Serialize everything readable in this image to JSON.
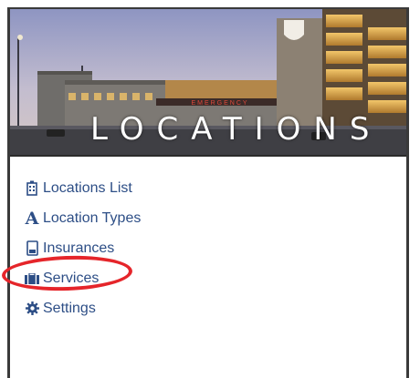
{
  "banner": {
    "title": "LOCATIONS",
    "sign_text": "EMERGENCY"
  },
  "menu": {
    "items": [
      {
        "label": "Locations List",
        "icon": "building-icon"
      },
      {
        "label": "Location Types",
        "icon": "font-a-icon"
      },
      {
        "label": "Insurances",
        "icon": "document-icon"
      },
      {
        "label": "Services",
        "icon": "suitcase-icon"
      },
      {
        "label": "Settings",
        "icon": "gear-icon"
      }
    ]
  },
  "colors": {
    "link": "#2d4e86",
    "highlight": "#e5252a"
  }
}
